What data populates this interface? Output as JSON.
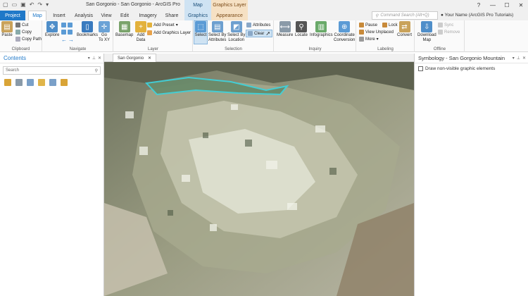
{
  "titlebar": {
    "title": "San Gorgonio - San Gorgonio - ArcGIS Pro",
    "ctx_map": "Map",
    "ctx_graphics_layer": "Graphics Layer",
    "help": "?",
    "minimize": "—",
    "maximize": "☐",
    "close": "✕"
  },
  "tabs": {
    "project": "Project",
    "map": "Map",
    "insert": "Insert",
    "analysis": "Analysis",
    "view": "View",
    "edit": "Edit",
    "imagery": "Imagery",
    "share": "Share",
    "graphics": "Graphics",
    "appearance": "Appearance"
  },
  "command_search": {
    "placeholder": "Command Search (Alt+Q)"
  },
  "user": {
    "name": "Your Name (ArcGIS Pro Tutorials)"
  },
  "ribbon": {
    "clipboard": {
      "label": "Clipboard",
      "paste": "Paste",
      "cut": "Cut",
      "copy": "Copy",
      "copy_path": "Copy Path"
    },
    "navigate": {
      "label": "Navigate",
      "explore": "Explore",
      "bookmarks": "Bookmarks",
      "go_to_xy": "Go\nTo XY"
    },
    "layer": {
      "label": "Layer",
      "basemap": "Basemap",
      "add_data": "Add\nData",
      "add_preset": "Add Preset",
      "add_graphics_layer": "Add Graphics Layer"
    },
    "selection": {
      "label": "Selection",
      "select": "Select",
      "select_by_attributes": "Select By\nAttributes",
      "select_by_location": "Select By\nLocation",
      "attributes": "Attributes",
      "clear": "Clear"
    },
    "inquiry": {
      "label": "Inquiry",
      "measure": "Measure",
      "locate": "Locate",
      "infographics": "Infographics",
      "coordinate_conversion": "Coordinate\nConversion"
    },
    "labeling": {
      "label": "Labeling",
      "pause": "Pause",
      "lock": "Lock",
      "view_unplaced": "View Unplaced",
      "more": "More",
      "convert": "Convert"
    },
    "offline": {
      "label": "Offline",
      "download_map": "Download\nMap",
      "sync": "Sync",
      "remove": "Remove"
    }
  },
  "contents": {
    "title": "Contents",
    "search_placeholder": "Search"
  },
  "map_view": {
    "tab_label": "San Gorgonio"
  },
  "symbology": {
    "title": "Symbology - San Gorgonio Mountain",
    "draw_non_visible": "Draw non-visible graphic elements"
  },
  "colors": {
    "accent": "#1f78c8",
    "ctx_map": "#cfe3f3",
    "ctx_graphics": "#f6e1c4",
    "graphic_outline": "#40d0d8"
  }
}
